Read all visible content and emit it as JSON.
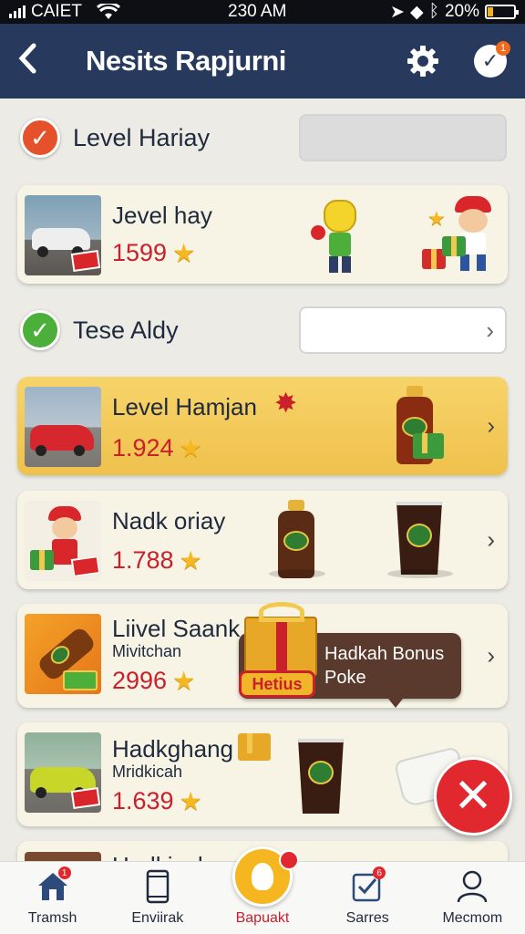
{
  "status_bar": {
    "carrier": "CAIET",
    "time": "230 AM",
    "battery": "20%",
    "battery_level": 0.2
  },
  "header": {
    "title": "Nesits Rapjurni",
    "notification_count": "1"
  },
  "filters": [
    {
      "label": "Level Hariay",
      "checked": true,
      "check_color": "#e5512a"
    },
    {
      "label": "Tese Aldy",
      "checked": true,
      "check_color": "#4caf3a"
    }
  ],
  "cards": [
    {
      "title": "Jevel hay",
      "subtitle": "",
      "score": "1599"
    },
    {
      "title": "Level Hamjan",
      "subtitle": "",
      "score": "1.924",
      "highlight": true
    },
    {
      "title": "Nadk oriay",
      "subtitle": "",
      "score": "1.788"
    },
    {
      "title": "Liivel Saank",
      "subtitle": "Mivitchan",
      "score": "2996"
    },
    {
      "title": "Hadkghang",
      "subtitle": "Mridkicah",
      "score": "1.639"
    }
  ],
  "tooltip": {
    "line1": "Hadkah Bonus",
    "line2": "Poke",
    "tag": "Hetius"
  },
  "partial_card_title": "Hadkicah",
  "bottom_nav": [
    {
      "label": "Tramsh",
      "icon": "home-icon",
      "badge": "1"
    },
    {
      "label": "Enviirak",
      "icon": "phone-icon"
    },
    {
      "label": "Bapuakt",
      "icon": "person-icon",
      "active": true
    },
    {
      "label": "Sarres",
      "icon": "checklist-icon",
      "badge": "6"
    },
    {
      "label": "Mecmom",
      "icon": "profile-icon"
    }
  ],
  "colors": {
    "header_bg": "#273a5e",
    "score_red": "#c9202b",
    "star": "#f5b823",
    "accent_yellow": "#f5b61f",
    "fab_red": "#e0282e"
  }
}
